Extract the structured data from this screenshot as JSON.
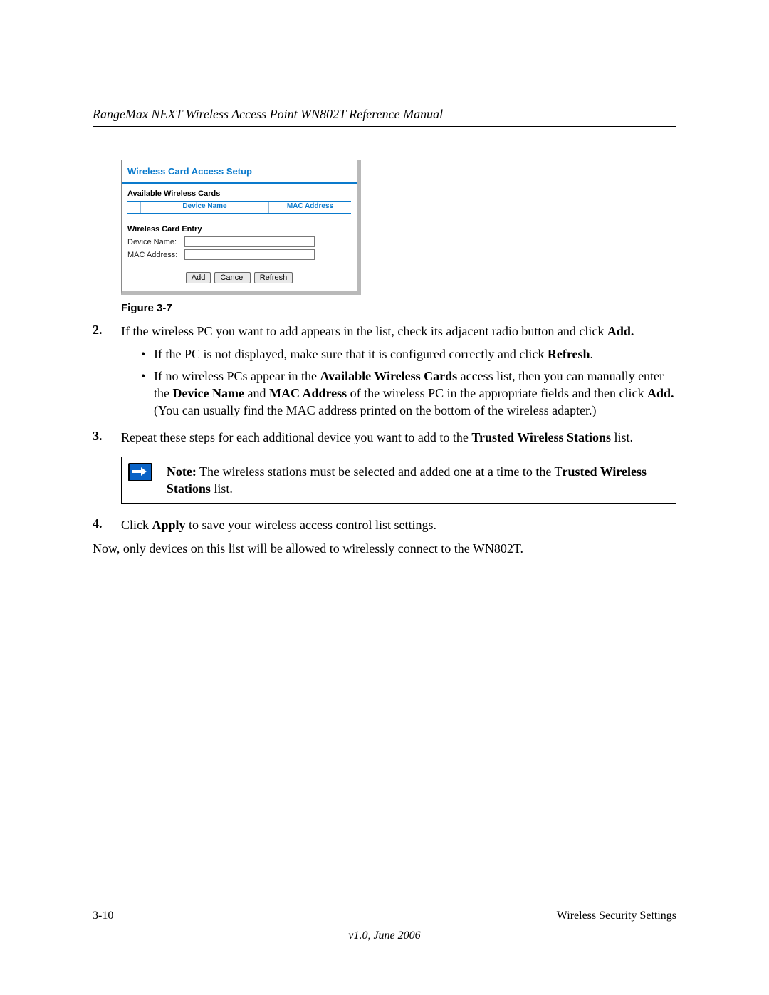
{
  "header": {
    "title": "RangeMax NEXT Wireless Access Point WN802T Reference Manual"
  },
  "panel": {
    "title": "Wireless Card Access Setup",
    "section1": "Available Wireless Cards",
    "col_device": "Device Name",
    "col_mac": "MAC Address",
    "section2": "Wireless Card Entry",
    "label_device": "Device Name:",
    "label_mac": "MAC Address:",
    "btn_add": "Add",
    "btn_cancel": "Cancel",
    "btn_refresh": "Refresh"
  },
  "caption": "Figure 3-7",
  "step2": {
    "num": "2.",
    "lead": "If the wireless PC you want to add appears in the list, check its adjacent radio button and click ",
    "bold_end": "Add.",
    "b1_a": "If the PC is not displayed, make sure that it is configured correctly and click ",
    "b1_bold": "Refresh",
    "b1_b": ".",
    "b2_a": "If no wireless PCs appear in the ",
    "b2_bold1": "Available Wireless Cards",
    "b2_b": " access list, then you can manually enter the ",
    "b2_bold2": "Device Name",
    "b2_c": " and ",
    "b2_bold3": "MAC Address",
    "b2_d": " of the wireless PC in the appropriate fields and then click ",
    "b2_bold4": "Add.",
    "b2_e": " (You can usually find the MAC address printed on the bottom of the wireless adapter.)"
  },
  "step3": {
    "num": "3.",
    "a": "Repeat these steps for each additional device you want to add to the ",
    "bold": "Trusted Wireless Stations",
    "b": " list."
  },
  "note": {
    "label": "Note:",
    "a": " The wireless stations must be selected and added one at a time to the T",
    "bold": "rusted Wireless Stations",
    "b": " list."
  },
  "step4": {
    "num": "4.",
    "a": "Click ",
    "bold": "Apply",
    "b": " to save your wireless access control list settings."
  },
  "closing": "Now, only devices on this list will be allowed to wirelessly connect to the WN802T.",
  "footer": {
    "page": "3-10",
    "section": "Wireless Security Settings",
    "version": "v1.0, June 2006"
  }
}
